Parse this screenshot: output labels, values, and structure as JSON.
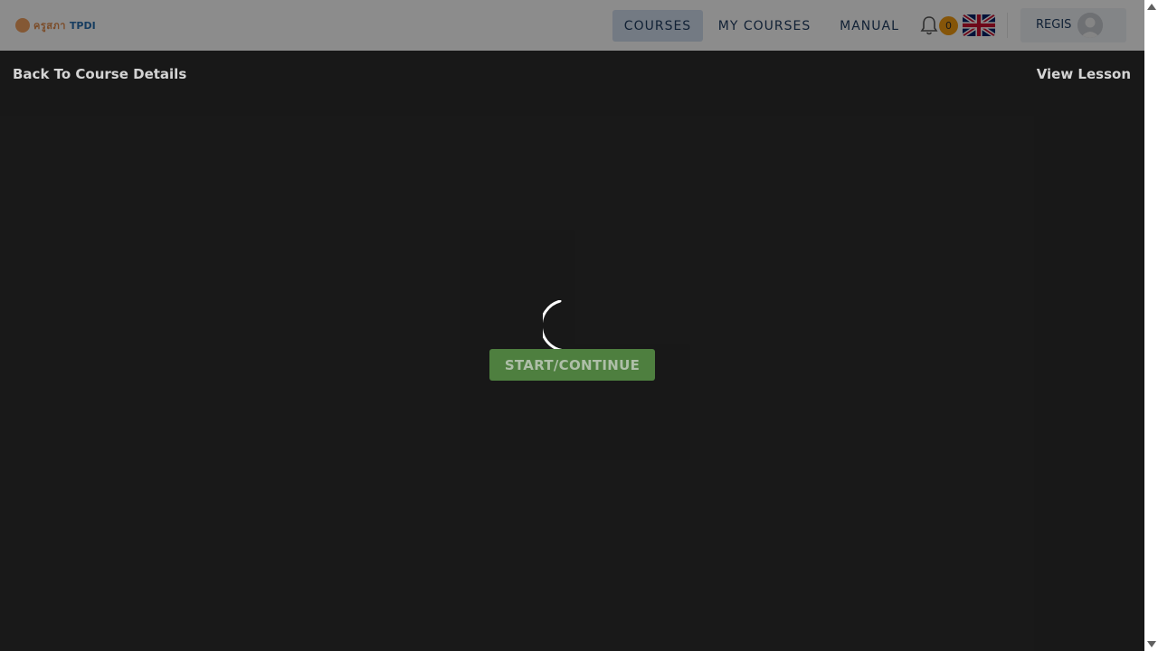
{
  "header": {
    "logo_text": "ครูสภา",
    "logo_brand": "TPDI",
    "nav": {
      "courses": "COURSES",
      "my_courses": "MY COURSES",
      "manual": "MANUAL"
    },
    "notification_count": "0",
    "user_name": "REGIS"
  },
  "content": {
    "back_link": "Back To Course Details",
    "view_lesson": "View Lesson",
    "start_button": "START/CONTINUE"
  },
  "colors": {
    "background": "#2d2d2d",
    "button": "#4e7f3f",
    "badge": "#f39c12",
    "nav_active": "#d2dfee"
  }
}
